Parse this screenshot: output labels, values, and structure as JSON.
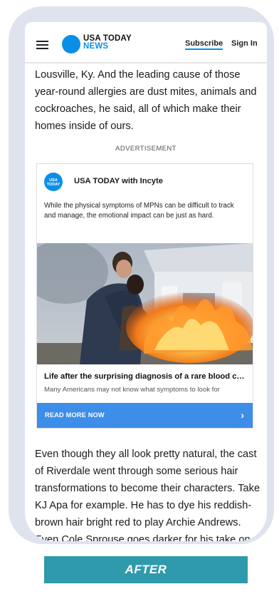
{
  "header": {
    "brand": "USA TODAY",
    "section": "NEWS",
    "subscribe_label": "Subscribe",
    "signin_label": "Sign In",
    "menu_icon": "hamburger-icon",
    "logo_color": "#0b8fe6"
  },
  "article": {
    "paragraph_top": "Lousville, Ky. And the leading cause of those year-round allergies are dust mites, animals and cockroaches, he said, all of which make their homes inside of ours.",
    "paragraph_bottom": "Even though they all look pretty natural, the cast of Riverdale went through some serious hair transformations to become their characters. Take KJ Apa for example. He has to dye his reddish-brown hair bright red to play Archie Andrews. Even Cole Sprouse goes darker for his take on Jughead Jones. Now that the hit"
  },
  "ad": {
    "label": "ADVERTISEMENT",
    "badge_line1": "USA",
    "badge_line2": "TODAY",
    "sponsor": "USA TODAY with Incyte",
    "description": "While the physical symptoms of MPNs can be difficult to track and manage, the emotional impact can be just as hard.",
    "title": "Life after the surprising diagnosis of a rare blood cancer",
    "subtitle": "Many Americans may not know what symptoms to look for",
    "cta_label": "READ MORE NOW",
    "cta_icon": "chevron-right-icon",
    "cta_color": "#3d8ee8"
  },
  "banner": {
    "label": "AFTER",
    "color": "#2e9aab"
  }
}
